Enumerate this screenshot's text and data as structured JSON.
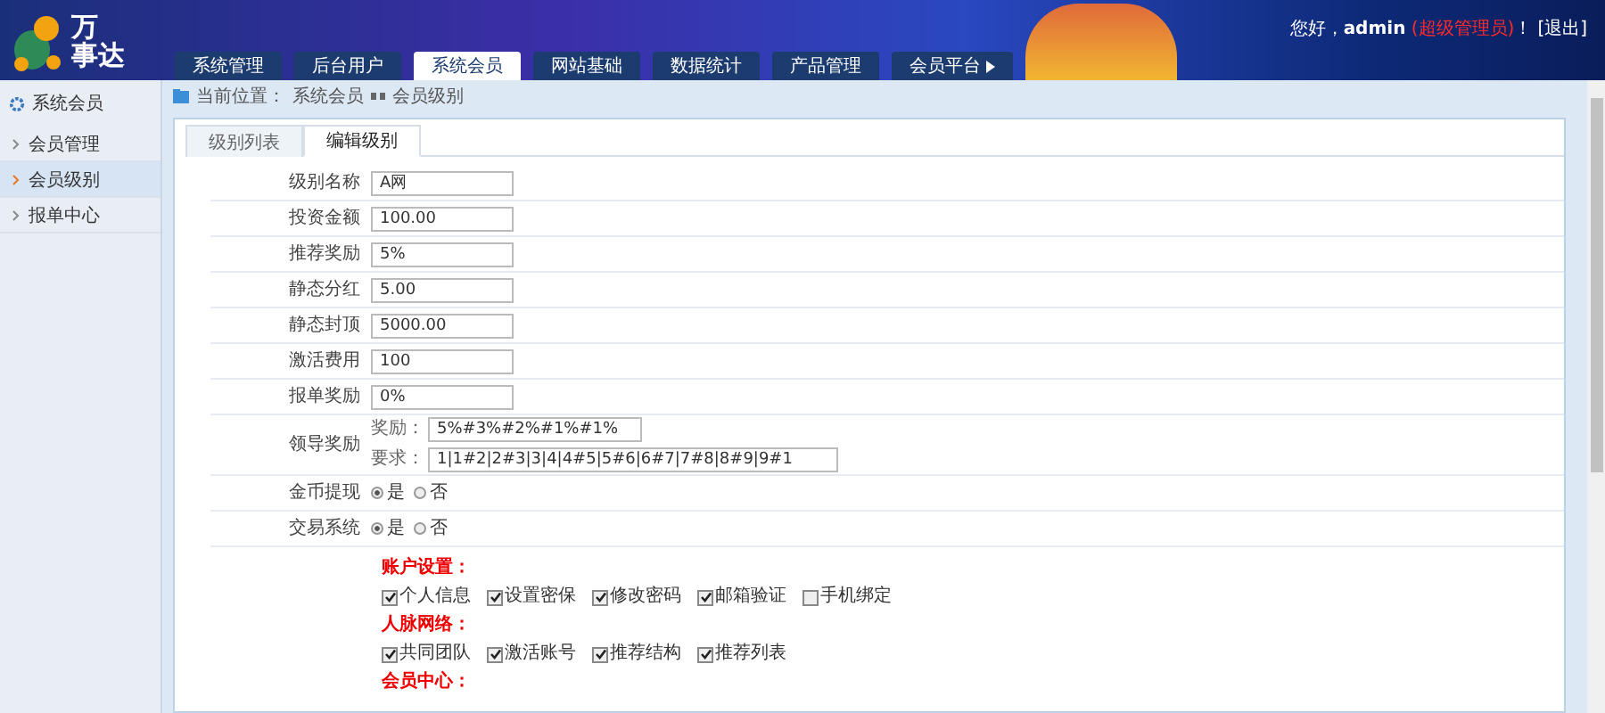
{
  "header": {
    "logo": [
      "万",
      "事达"
    ],
    "greeting": "您好，",
    "user": "admin",
    "role": "(超级管理员)",
    "exclaim": "！",
    "logout": "[退出]"
  },
  "nav": [
    {
      "label": "系统管理",
      "selected": false
    },
    {
      "label": "后台用户",
      "selected": false
    },
    {
      "label": "系统会员",
      "selected": true
    },
    {
      "label": "网站基础",
      "selected": false
    },
    {
      "label": "数据统计",
      "selected": false
    },
    {
      "label": "产品管理",
      "selected": false
    },
    {
      "label": "会员平台",
      "selected": false,
      "more": true
    }
  ],
  "sidebar": {
    "title": "系统会员",
    "items": [
      {
        "label": "会员管理",
        "selected": false
      },
      {
        "label": "会员级别",
        "selected": true
      },
      {
        "label": "报单中心",
        "selected": false
      }
    ]
  },
  "breadcrumb": {
    "label": "当前位置：",
    "path": [
      "系统会员",
      "会员级别"
    ]
  },
  "tabs": [
    {
      "label": "级别列表",
      "selected": false
    },
    {
      "label": "编辑级别",
      "selected": true
    }
  ],
  "fields": [
    {
      "kind": "text",
      "label": "级别名称",
      "value": "A网"
    },
    {
      "kind": "text",
      "label": "投资金额",
      "value": "100.00"
    },
    {
      "kind": "text",
      "label": "推荐奖励",
      "value": "5%"
    },
    {
      "kind": "text",
      "label": "静态分红",
      "value": "5.00"
    },
    {
      "kind": "text",
      "label": "静态封顶",
      "value": "5000.00"
    },
    {
      "kind": "text",
      "label": "激活费用",
      "value": "100"
    },
    {
      "kind": "text",
      "label": "报单奖励",
      "value": "0%"
    },
    {
      "kind": "multi",
      "label": "领导奖励",
      "inputs": [
        {
          "label": "奖励：",
          "value": "5%#3%#2%#1%#1%"
        },
        {
          "label": "要求：",
          "value": "1|1#2|2#3|3|4|4#5|5#6|6#7|7#8|8#9|9#1"
        }
      ]
    },
    {
      "kind": "radio",
      "label": "金币提现",
      "options": [
        {
          "label": "是",
          "selected": true
        },
        {
          "label": "否",
          "selected": false
        }
      ]
    },
    {
      "kind": "radio",
      "label": "交易系统",
      "options": [
        {
          "label": "是",
          "selected": true
        },
        {
          "label": "否",
          "selected": false
        }
      ]
    }
  ],
  "permissions": [
    {
      "title": "账户设置：",
      "items": [
        {
          "label": "个人信息",
          "checked": true
        },
        {
          "label": "设置密保",
          "checked": true
        },
        {
          "label": "修改密码",
          "checked": true
        },
        {
          "label": "邮箱验证",
          "checked": true
        },
        {
          "label": "手机绑定",
          "checked": false
        }
      ]
    },
    {
      "title": "人脉网络：",
      "items": [
        {
          "label": "共同团队",
          "checked": true
        },
        {
          "label": "激活账号",
          "checked": true
        },
        {
          "label": "推荐结构",
          "checked": true
        },
        {
          "label": "推荐列表",
          "checked": true
        }
      ]
    },
    {
      "title": "会员中心："
    }
  ]
}
